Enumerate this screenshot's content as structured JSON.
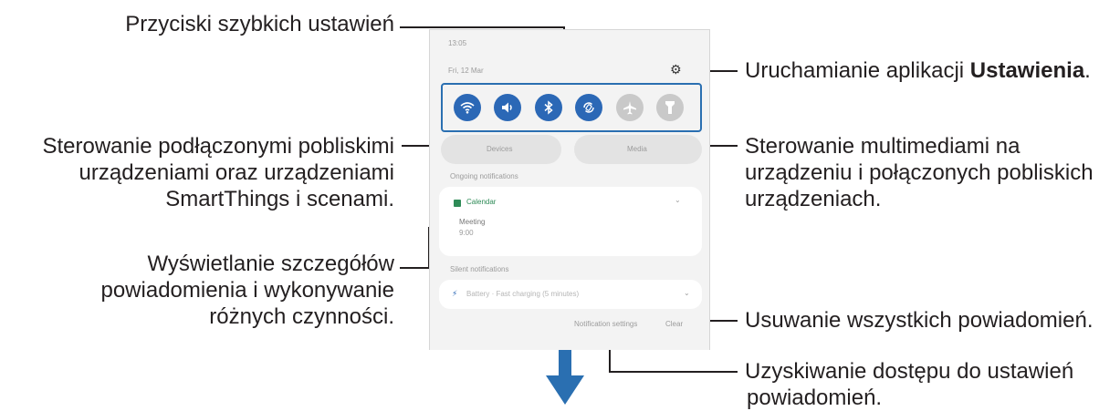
{
  "callouts": {
    "quick_settings": "Przyciski szybkich ustawień",
    "settings_line": "Uruchamianie aplikacji ",
    "settings_app": "Ustawienia",
    "settings_end": ".",
    "devices": [
      "Sterowanie podłączonymi pobliskimi",
      "urządzeniami oraz urządzeniami",
      "SmartThings i scenami."
    ],
    "media": [
      "Sterowanie multimediami na",
      "urządzeniu i połączonych pobliskich",
      "urządzeniach."
    ],
    "details": [
      "Wyświetlanie szczegółów",
      "powiadomienia i wykonywanie",
      "różnych czynności."
    ],
    "clear_all": "Usuwanie wszystkich powiadomień.",
    "notif_settings": [
      "Uzyskiwanie dostępu do ustawień",
      "powiadomień."
    ]
  },
  "phone": {
    "time": "13:05",
    "date": "Fri, 12 Mar",
    "devices_btn": "Devices",
    "media_btn": "Media",
    "ongoing_header": "Ongoing notifications",
    "app_name": "Calendar",
    "event_title": "Meeting",
    "event_time": "9:00",
    "silent_header": "Silent notifications",
    "silent_text": "Battery · Fast charging (5 minutes)",
    "notif_settings_btn": "Notification settings",
    "clear_btn": "Clear"
  },
  "quick_settings_buttons": [
    {
      "icon": "wifi-icon",
      "state": "on"
    },
    {
      "icon": "sound-icon",
      "state": "on"
    },
    {
      "icon": "bluetooth-icon",
      "state": "on"
    },
    {
      "icon": "auto-rotate-icon",
      "state": "on"
    },
    {
      "icon": "airplane-icon",
      "state": "off"
    },
    {
      "icon": "flashlight-icon",
      "state": "off"
    }
  ],
  "colors": {
    "accent": "#2b68b6",
    "leader": "#231f20",
    "arrow": "#2a6fb1"
  }
}
